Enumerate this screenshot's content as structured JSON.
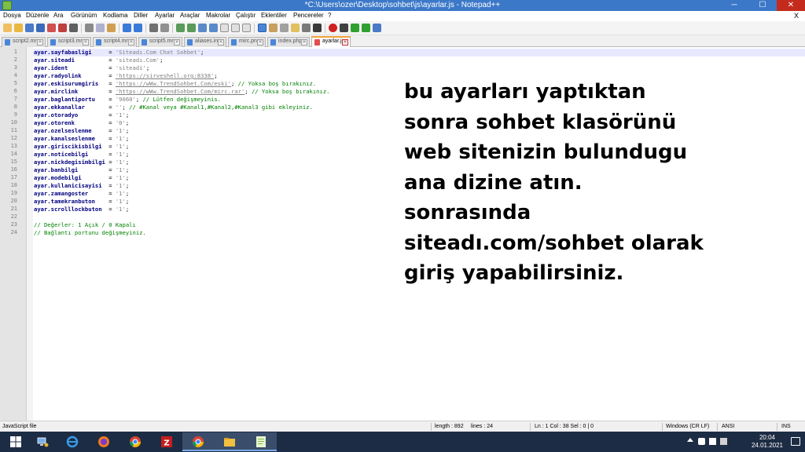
{
  "window": {
    "title": "*C:\\Users\\ozer\\Desktop\\sohbet\\js\\ayarlar.js - Notepad++",
    "min_label": "─",
    "max_label": "☐",
    "close_label": "✕"
  },
  "menu": {
    "items": [
      "Dosya",
      "Düzenle",
      "Ara",
      "Görünüm",
      "Kodlama",
      "Diller",
      "Ayarlar",
      "Araçlar",
      "Makrolar",
      "Çalıştır",
      "Eklentiler",
      "Pencereler",
      "?"
    ],
    "close_label": "X"
  },
  "tabs": [
    {
      "label": "script2.mrc",
      "active": false
    },
    {
      "label": "script3.mrc",
      "active": false
    },
    {
      "label": "script4.mrc",
      "active": false
    },
    {
      "label": "script5.mrc",
      "active": false
    },
    {
      "label": "aliases.ini",
      "active": false
    },
    {
      "label": "mirc.png",
      "active": false
    },
    {
      "label": "index.php",
      "active": false
    },
    {
      "label": "ayarlar.js",
      "active": true
    }
  ],
  "tab_close_glyph": "✕",
  "code": {
    "line_numbers": [
      "1",
      "2",
      "3",
      "4",
      "5",
      "6",
      "7",
      "8",
      "9",
      "10",
      "11",
      "12",
      "13",
      "14",
      "15",
      "16",
      "17",
      "18",
      "19",
      "20",
      "21",
      "22",
      "23",
      "24"
    ],
    "lines": [
      {
        "key": "ayar.sayfabasligi",
        "value": "'Siteadı.Com Chat Sohbet'",
        "value_kind": "s",
        "tail": ";",
        "comment": ""
      },
      {
        "key": "ayar.siteadi",
        "value": "'siteadı.Com'",
        "value_kind": "s",
        "tail": ";",
        "comment": ""
      },
      {
        "key": "ayar.ident",
        "value": "'siteadi'",
        "value_kind": "s",
        "tail": ";",
        "comment": ""
      },
      {
        "key": "ayar.radyolink",
        "value": "'https://sirveshell.org:8338'",
        "value_kind": "u",
        "tail": ";",
        "comment": ""
      },
      {
        "key": "ayar.eskisurumgiris",
        "value": "'https://wWw.TrendSohbet.Com/eski'",
        "value_kind": "u",
        "tail": ";",
        "comment": " // Yoksa boş bırakınız."
      },
      {
        "key": "ayar.mirclink",
        "value": "'https://wWw.TrendSohbet.Com/mirc.rar'",
        "value_kind": "u",
        "tail": ";",
        "comment": " // Yoksa boş bırakınız."
      },
      {
        "key": "ayar.baglantiportu",
        "value": "'9060'",
        "value_kind": "s",
        "tail": ";",
        "comment": " // Lütfen değişmeyinis."
      },
      {
        "key": "ayar.ekkanallar",
        "value": "''",
        "value_kind": "s",
        "tail": ";",
        "comment": " // #Kanal veya #Kanal1,#Kanal2,#Kanal3 gibi ekleyiniz."
      },
      {
        "key": "ayar.otoradyo",
        "value": "'1'",
        "value_kind": "s",
        "tail": ";",
        "comment": ""
      },
      {
        "key": "ayar.otorenk",
        "value": "'0'",
        "value_kind": "s",
        "tail": ";",
        "comment": ""
      },
      {
        "key": "ayar.ozelseslenme",
        "value": "'1'",
        "value_kind": "s",
        "tail": ";",
        "comment": ""
      },
      {
        "key": "ayar.kanalseslenme",
        "value": "'1'",
        "value_kind": "s",
        "tail": ";",
        "comment": ""
      },
      {
        "key": "ayar.giriscikisbilgi",
        "value": "'1'",
        "value_kind": "s",
        "tail": ";",
        "comment": ""
      },
      {
        "key": "ayar.noticebilgi",
        "value": "'1'",
        "value_kind": "s",
        "tail": ";",
        "comment": ""
      },
      {
        "key": "ayar.nickdegisimbilgi",
        "value": "'1'",
        "value_kind": "s",
        "tail": ";",
        "comment": ""
      },
      {
        "key": "ayar.banbilgi",
        "value": "'1'",
        "value_kind": "s",
        "tail": ";",
        "comment": ""
      },
      {
        "key": "ayar.modebilgi",
        "value": "'1'",
        "value_kind": "s",
        "tail": ";",
        "comment": ""
      },
      {
        "key": "ayar.kullanicisayisi",
        "value": "'1'",
        "value_kind": "s",
        "tail": ";",
        "comment": ""
      },
      {
        "key": "ayar.zamangoster",
        "value": "'1'",
        "value_kind": "s",
        "tail": ";",
        "comment": ""
      },
      {
        "key": "ayar.tamekranbuton",
        "value": "'1'",
        "value_kind": "s",
        "tail": ";",
        "comment": ""
      },
      {
        "key": "ayar.scrolllockbuton",
        "value": "'1'",
        "value_kind": "s",
        "tail": ";",
        "comment": ""
      },
      {
        "key": "",
        "value": "",
        "value_kind": "s",
        "tail": "",
        "comment": ""
      },
      {
        "key": "",
        "value": "",
        "value_kind": "s",
        "tail": "",
        "comment": "// Değerler: 1 Açık / 0 Kapalı"
      },
      {
        "key": "",
        "value": "",
        "value_kind": "s",
        "tail": "",
        "comment": "// Bağlantı portunu değişmeyiniz."
      }
    ],
    "assign_op": "= "
  },
  "overlay": {
    "lines": [
      "bu ayarları yaptıktan",
      "sonra sohbet klasörünü",
      "web sitenizin bulundugu",
      "ana dizine atın.",
      "sonrasında",
      "siteadı.com/sohbet olarak",
      "giriş yapabilirsiniz."
    ]
  },
  "status": {
    "file_type": "JavaScript file",
    "length": "length : 892",
    "lines": "lines : 24",
    "position": "Ln : 1    Col : 38    Sel : 0 | 0",
    "eol": "Windows (CR LF)",
    "encoding": "ANSI",
    "mode": "INS"
  },
  "taskbar": {
    "apps": [
      "windows-start",
      "network-app",
      "edge",
      "firefox",
      "chrome",
      "filezilla",
      "chrome-2",
      "file-explorer",
      "notepad-plus-plus"
    ],
    "time": "20:04",
    "date": "24.01.2021"
  }
}
